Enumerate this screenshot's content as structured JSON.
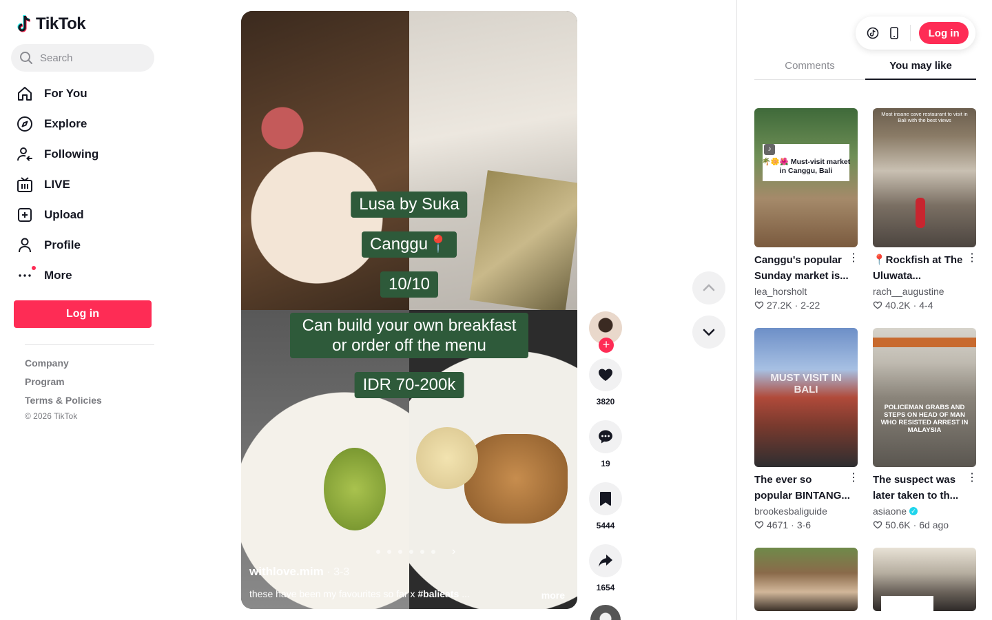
{
  "brand": {
    "name": "TikTok",
    "accent": "#fe2c55",
    "accent2": "#25f4ee"
  },
  "search": {
    "placeholder": "Search"
  },
  "nav": [
    {
      "label": "For You",
      "icon": "home-icon"
    },
    {
      "label": "Explore",
      "icon": "compass-icon"
    },
    {
      "label": "Following",
      "icon": "following-icon"
    },
    {
      "label": "LIVE",
      "icon": "live-icon"
    },
    {
      "label": "Upload",
      "icon": "upload-icon"
    },
    {
      "label": "Profile",
      "icon": "profile-icon"
    },
    {
      "label": "More",
      "icon": "more-icon"
    }
  ],
  "sidebar": {
    "login_label": "Log in"
  },
  "footer": {
    "links": [
      "Company",
      "Program",
      "Terms & Policies"
    ],
    "copyright": "© 2026 TikTok"
  },
  "video": {
    "overlays": [
      "Lusa by Suka",
      "Canggu📍",
      "10/10",
      "Can build your own breakfast or order off the menu",
      "IDR 70-200k"
    ],
    "author": "withlove.mim",
    "date": "3-3",
    "caption_text": "these have been my favourites so far x ",
    "caption_tag": "#balieats",
    "caption_more": "...",
    "more_label": "more"
  },
  "actions": {
    "likes": "3820",
    "comments": "19",
    "saves": "5444",
    "shares": "1654"
  },
  "right": {
    "login_label": "Log in",
    "tabs": [
      "Comments",
      "You may like"
    ],
    "active_tab": 1
  },
  "cards": [
    {
      "title": "Canggu's popular Sunday market is...",
      "author": "lea_horsholt",
      "likes": "27.2K",
      "date": "2-22",
      "overlay": "🌴🌼🌺 Must-visit market in Canggu, Bali",
      "verified": false
    },
    {
      "title": "📍Rockfish at The Uluwata...",
      "author": "rach__augustine",
      "likes": "40.2K",
      "date": "4-4",
      "overlay": "Most insane cave restaurant to visit in Bali with the best views",
      "verified": false
    },
    {
      "title": "The ever so popular BINTANG...",
      "author": "brookesbaliguide",
      "likes": "4671",
      "date": "3-6",
      "overlay": "MUST VISIT IN BALI",
      "verified": false
    },
    {
      "title": "The suspect was later taken to th...",
      "author": "asiaone",
      "likes": "50.6K",
      "date": "6d ago",
      "overlay": "POLICEMAN GRABS AND STEPS ON HEAD OF MAN WHO RESISTED ARREST IN MALAYSIA",
      "verified": true
    },
    {
      "title": "",
      "author": "",
      "likes": "",
      "date": "",
      "overlay": "",
      "verified": false
    },
    {
      "title": "",
      "author": "",
      "likes": "",
      "date": "",
      "overlay": "",
      "verified": false
    }
  ]
}
